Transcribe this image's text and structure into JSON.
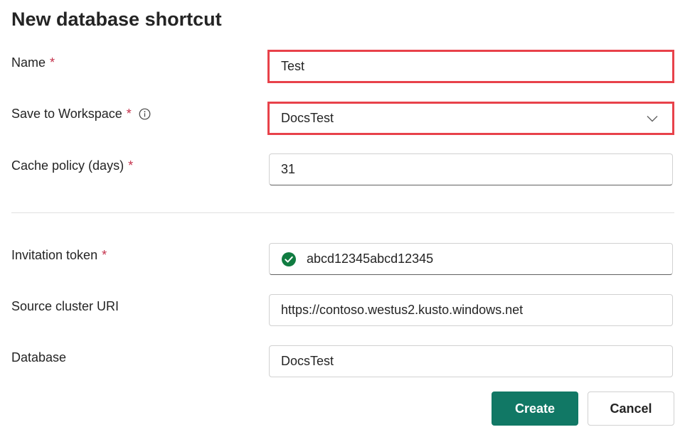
{
  "dialog": {
    "title": "New database shortcut",
    "required_marker": "*"
  },
  "fields": {
    "name": {
      "label": "Name",
      "value": "Test"
    },
    "workspace": {
      "label": "Save to Workspace",
      "value": "DocsTest",
      "icon": "info-icon"
    },
    "cache_policy": {
      "label": "Cache policy (days)",
      "value": "31"
    },
    "invitation_token": {
      "label": "Invitation token",
      "value": "abcd12345abcd12345",
      "status_icon": "check-circle-icon"
    },
    "source_cluster_uri": {
      "label": "Source cluster URI",
      "value": "https://contoso.westus2.kusto.windows.net"
    },
    "database": {
      "label": "Database",
      "value": "DocsTest"
    }
  },
  "actions": {
    "create_label": "Create",
    "cancel_label": "Cancel"
  },
  "colors": {
    "primary": "#117865",
    "highlight": "#e8424a",
    "required": "#c4314b",
    "success": "#107c41"
  }
}
